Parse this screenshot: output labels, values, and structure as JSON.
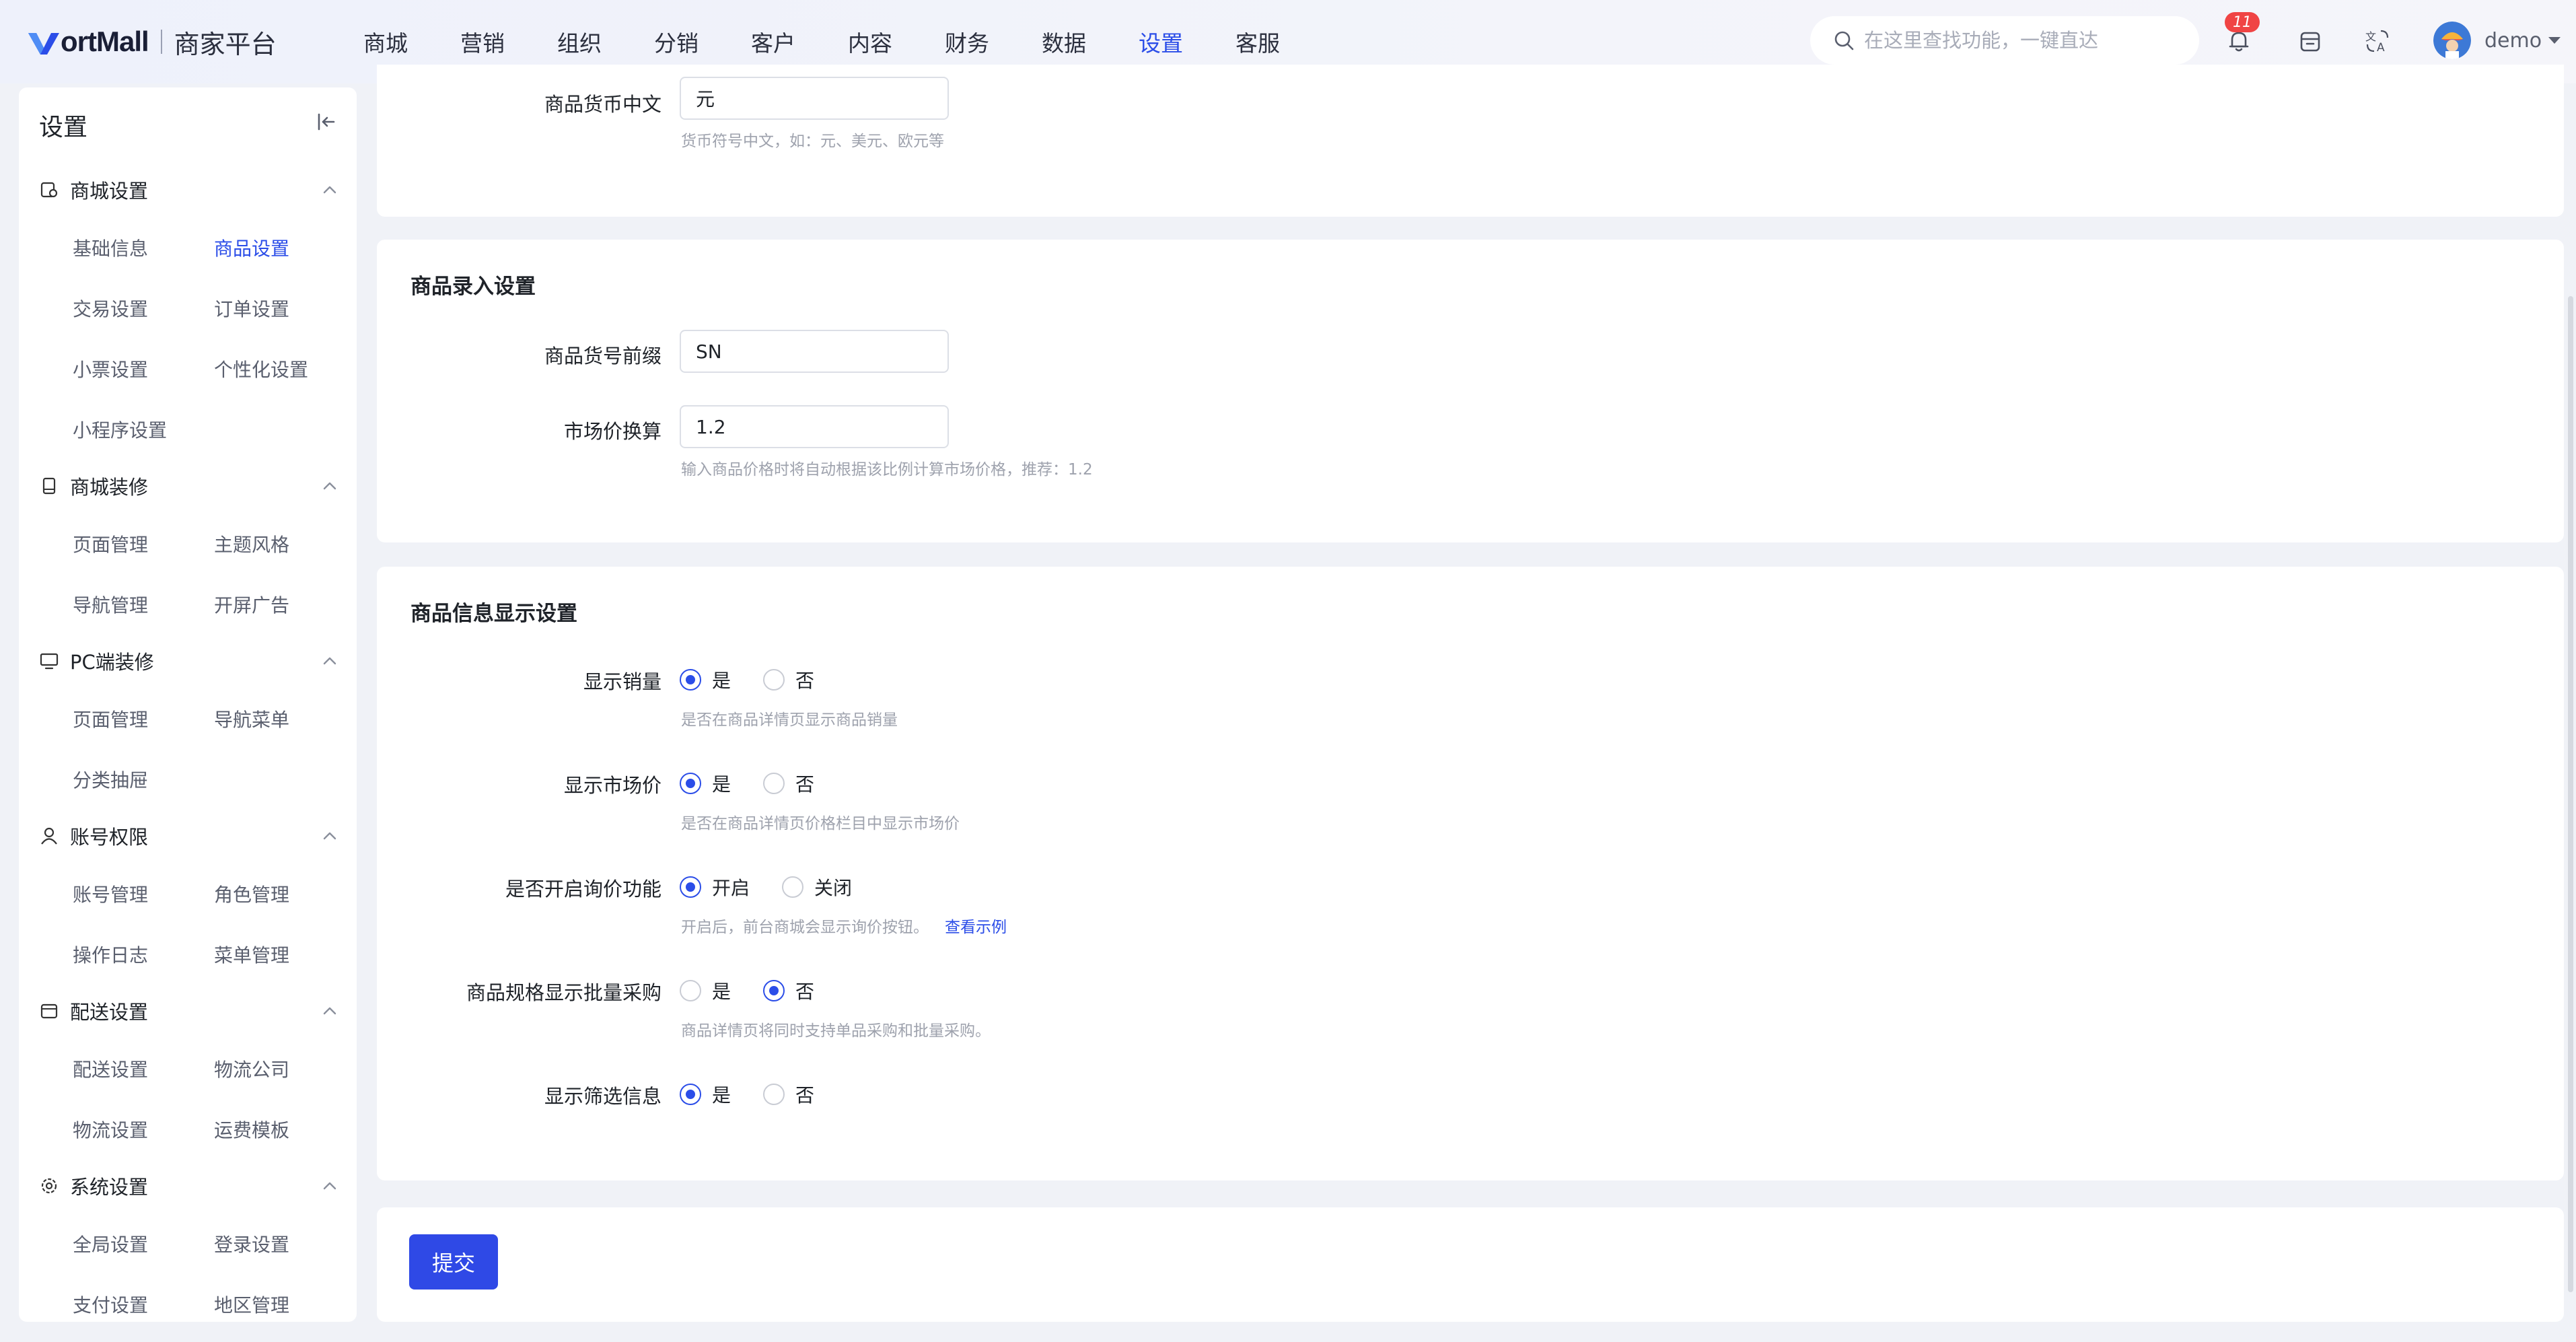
{
  "brand": {
    "logo_text": "ortMall",
    "subtitle": "商家平台"
  },
  "nav": [
    "商城",
    "营销",
    "组织",
    "分销",
    "客户",
    "内容",
    "财务",
    "数据",
    "设置",
    "客服"
  ],
  "nav_active": "设置",
  "search": {
    "placeholder": "在这里查找功能，一键直达"
  },
  "notifications": {
    "count": "11"
  },
  "user": {
    "name": "demo"
  },
  "sidebar": {
    "title": "设置",
    "groups": [
      {
        "title": "商城设置",
        "icon": "store-settings-icon",
        "items": [
          "基础信息",
          "商品设置",
          "交易设置",
          "订单设置",
          "小票设置",
          "个性化设置",
          "小程序设置"
        ]
      },
      {
        "title": "商城装修",
        "icon": "mobile-icon",
        "items": [
          "页面管理",
          "主题风格",
          "导航管理",
          "开屏广告"
        ]
      },
      {
        "title": "PC端装修",
        "icon": "monitor-icon",
        "items": [
          "页面管理",
          "导航菜单",
          "分类抽屉"
        ]
      },
      {
        "title": "账号权限",
        "icon": "user-icon",
        "items": [
          "账号管理",
          "角色管理",
          "操作日志",
          "菜单管理"
        ]
      },
      {
        "title": "配送设置",
        "icon": "delivery-icon",
        "items": [
          "配送设置",
          "物流公司",
          "物流设置",
          "运费模板"
        ]
      },
      {
        "title": "系统设置",
        "icon": "system-gear-icon",
        "items": [
          "全局设置",
          "登录设置",
          "支付设置",
          "地区管理"
        ]
      }
    ],
    "active_item": "商品设置"
  },
  "currency_card": {
    "label": "商品货币中文",
    "value": "元",
    "hint": "货币符号中文，如：元、美元、欧元等"
  },
  "entry_card": {
    "title": "商品录入设置",
    "prefix_label": "商品货号前缀",
    "prefix_value": "SN",
    "ratio_label": "市场价换算",
    "ratio_value": "1.2",
    "ratio_hint": "输入商品价格时将自动根据该比例计算市场价格，推荐：1.2"
  },
  "display_card": {
    "title": "商品信息显示设置",
    "rows": [
      {
        "label": "显示销量",
        "opt1": "是",
        "opt2": "否",
        "selected": 1,
        "hint": "是否在商品详情页显示商品销量"
      },
      {
        "label": "显示市场价",
        "opt1": "是",
        "opt2": "否",
        "selected": 1,
        "hint": "是否在商品详情页价格栏目中显示市场价"
      },
      {
        "label": "是否开启询价功能",
        "opt1": "开启",
        "opt2": "关闭",
        "selected": 1,
        "hint": "开启后，前台商城会显示询价按钮。",
        "link": "查看示例"
      },
      {
        "label": "商品规格显示批量采购",
        "opt1": "是",
        "opt2": "否",
        "selected": 2,
        "hint": "商品详情页将同时支持单品采购和批量采购。"
      },
      {
        "label": "显示筛选信息",
        "opt1": "是",
        "opt2": "否",
        "selected": 1
      }
    ]
  },
  "submit_label": "提交",
  "colors": {
    "accent": "#2b4de8",
    "badge": "#f04444"
  }
}
